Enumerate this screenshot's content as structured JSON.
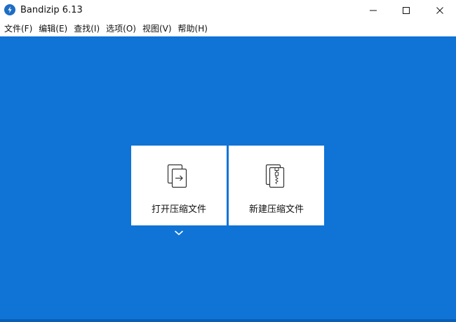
{
  "window": {
    "title": "Bandizip 6.13",
    "icon": "bandizip-logo-icon",
    "controls": [
      "minimize-icon",
      "maximize-icon",
      "close-icon"
    ]
  },
  "menubar": {
    "items": [
      {
        "label": "文件(F)"
      },
      {
        "label": "编辑(E)"
      },
      {
        "label": "查找(I)"
      },
      {
        "label": "选项(O)"
      },
      {
        "label": "视图(V)"
      },
      {
        "label": "帮助(H)"
      }
    ]
  },
  "main": {
    "tiles": [
      {
        "label": "打开压缩文件",
        "icon": "open-archive-icon"
      },
      {
        "label": "新建压缩文件",
        "icon": "new-archive-icon"
      }
    ],
    "dropdown_icon": "chevron-down-icon"
  },
  "colors": {
    "background_blue": "#0f74d6",
    "tile_background": "#ffffff",
    "text": "#111111"
  }
}
